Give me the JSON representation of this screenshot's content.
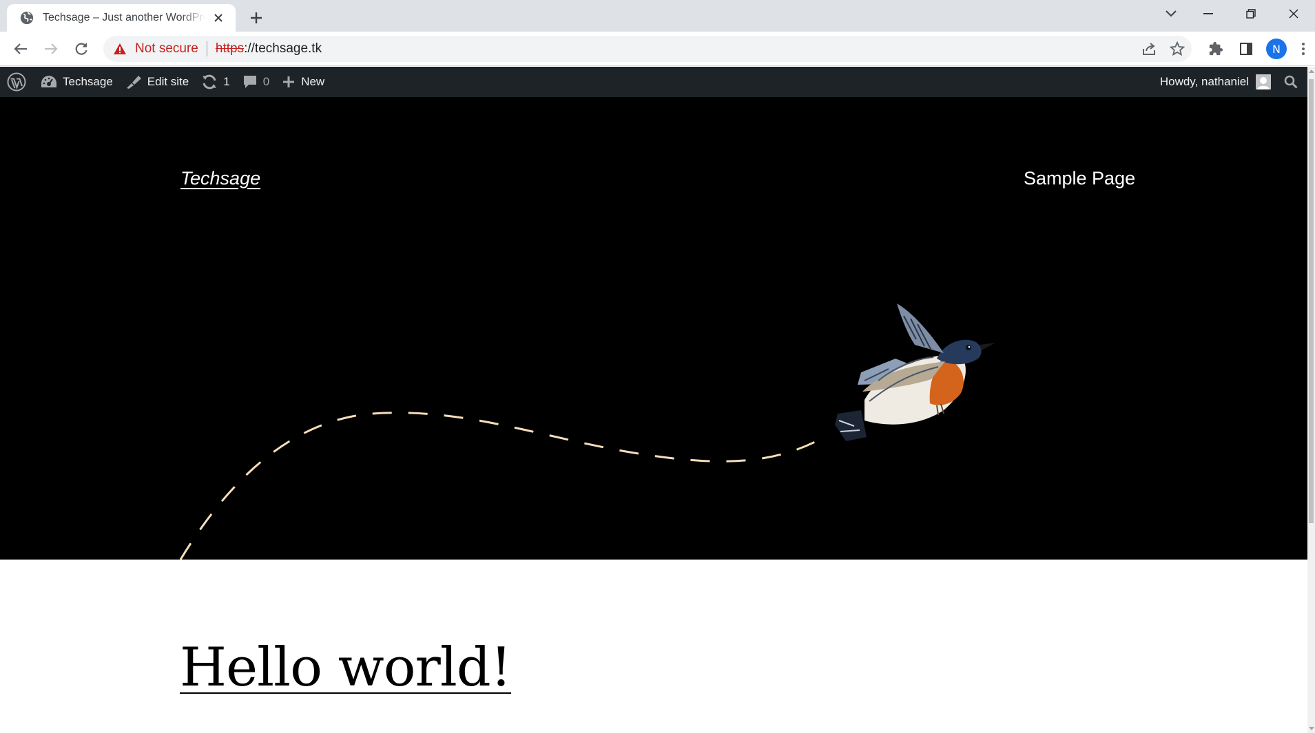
{
  "browser": {
    "tab_title": "Techsage – Just another WordPress site",
    "new_tab_icon": "plus-icon",
    "security_label": "Not secure",
    "url_scheme": "https",
    "url_rest": "://techsage.tk",
    "profile_initial": "N",
    "colors": {
      "tabstrip": "#dee1e6",
      "not_secure": "#c5221f",
      "profile": "#1a73e8"
    }
  },
  "adminbar": {
    "site_name": "Techsage",
    "edit_site": "Edit site",
    "updates_count": "1",
    "comments_count": "0",
    "new_label": "New",
    "howdy": "Howdy, nathaniel",
    "background": "#1d2327"
  },
  "site": {
    "title": "Techsage",
    "nav": [
      "Sample Page"
    ],
    "hero_background": "#000000"
  },
  "post": {
    "title": "Hello world!"
  }
}
